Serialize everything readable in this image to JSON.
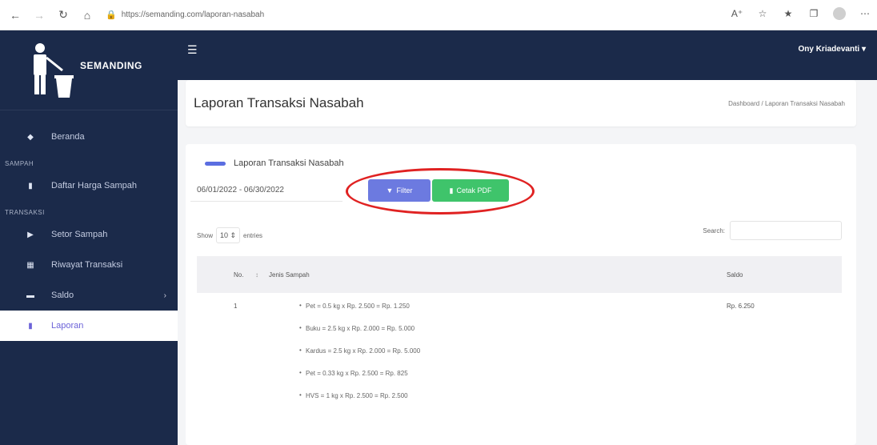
{
  "browser": {
    "url": "https://semanding.com/laporan-nasabah"
  },
  "sidebar": {
    "brand": "SEMANDING",
    "items": [
      {
        "label": "Beranda",
        "icon": "dashboard-icon"
      },
      {
        "section": "SAMPAH"
      },
      {
        "label": "Daftar Harga Sampah",
        "icon": "trash-icon"
      },
      {
        "section": "TRANSAKSI"
      },
      {
        "label": "Setor Sampah",
        "icon": "truck-icon"
      },
      {
        "label": "Riwayat Transaksi",
        "icon": "receipt-icon"
      },
      {
        "label": "Saldo",
        "icon": "wallet-icon"
      },
      {
        "label": "Laporan",
        "icon": "report-icon"
      }
    ]
  },
  "topnav": {
    "user": "Ony Kriadevanti"
  },
  "header": {
    "title": "Laporan Transaksi Nasabah",
    "breadcrumb_home": "Dashboard",
    "breadcrumb_sep": "/",
    "breadcrumb_current": "Laporan Transaksi Nasabah"
  },
  "card": {
    "title": "Laporan Transaksi Nasabah",
    "date_range": "06/01/2022 - 06/30/2022",
    "filter_label": "Filter",
    "pdf_label": "Cetak PDF",
    "show_label": "Show",
    "entries_value": "10",
    "entries_label": "entries",
    "search_label": "Search:"
  },
  "table": {
    "headers": {
      "no": "No.",
      "jenis": "Jenis Sampah",
      "saldo": "Saldo"
    },
    "rows": [
      {
        "no": "1",
        "items": [
          "Pet = 0.5 kg x Rp. 2.500 = Rp. 1.250",
          "Buku = 2.5 kg x Rp. 2.000 = Rp. 5.000",
          "Kardus = 2.5 kg x Rp. 2.000 = Rp. 5.000",
          "Pet = 0.33 kg x Rp. 2.500 = Rp. 825",
          "HVS = 1 kg x Rp. 2.500 = Rp. 2.500"
        ],
        "saldo": "Rp. 6.250"
      }
    ]
  }
}
